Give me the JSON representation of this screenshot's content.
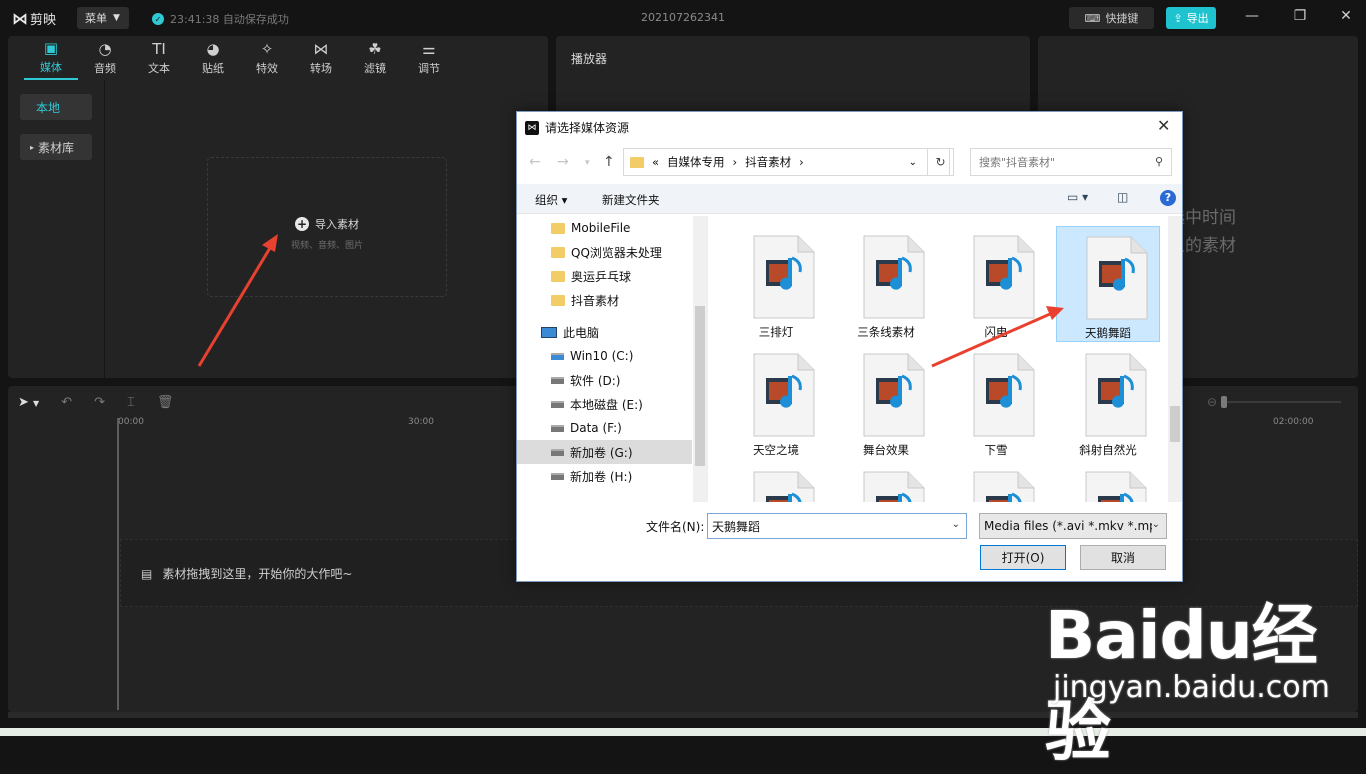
{
  "app": {
    "brand": "剪映",
    "menu_label": "菜单",
    "autosave": "23:41:38 自动保存成功",
    "project_name": "202107262341",
    "shortcut_label": "快捷键",
    "export_label": "导出"
  },
  "media_tabs": [
    {
      "label": "媒体",
      "icon": "media-icon"
    },
    {
      "label": "音频",
      "icon": "audio-icon"
    },
    {
      "label": "文本",
      "icon": "text-icon"
    },
    {
      "label": "贴纸",
      "icon": "sticker-icon"
    },
    {
      "label": "特效",
      "icon": "effects-icon"
    },
    {
      "label": "转场",
      "icon": "transition-icon"
    },
    {
      "label": "滤镜",
      "icon": "filter-icon"
    },
    {
      "label": "调节",
      "icon": "adjust-icon"
    }
  ],
  "media_side": {
    "local": "本地",
    "library": "素材库"
  },
  "import": {
    "label": "导入素材",
    "sub": "视频、音频、图片"
  },
  "player": {
    "title": "播放器"
  },
  "inspector": {
    "hint_line1": "选中时间",
    "hint_line2": "上的素材"
  },
  "timeline": {
    "ruler": [
      "00:00",
      "30:00",
      "02:00:00"
    ],
    "drop_hint": "素材拖拽到这里，开始你的大作吧~"
  },
  "dialog": {
    "title": "请选择媒体资源",
    "path": [
      "«",
      "自媒体专用",
      "›",
      "抖音素材",
      "›"
    ],
    "search_placeholder": "搜索\"抖音素材\"",
    "organize": "组织 ▾",
    "new_folder": "新建文件夹",
    "tree": [
      {
        "label": "MobileFile",
        "kind": "folder"
      },
      {
        "label": "QQ浏览器未处理",
        "kind": "folder"
      },
      {
        "label": "奥运乒乓球",
        "kind": "folder"
      },
      {
        "label": "抖音素材",
        "kind": "folder"
      },
      {
        "label": "此电脑",
        "kind": "pc"
      },
      {
        "label": "Win10 (C:)",
        "kind": "drive"
      },
      {
        "label": "软件 (D:)",
        "kind": "drive"
      },
      {
        "label": "本地磁盘 (E:)",
        "kind": "drive"
      },
      {
        "label": "Data (F:)",
        "kind": "drive"
      },
      {
        "label": "新加卷 (G:)",
        "kind": "drive"
      },
      {
        "label": "新加卷 (H:)",
        "kind": "drive"
      }
    ],
    "files": [
      "三排灯",
      "三条线素材",
      "闪电",
      "天鹅舞蹈",
      "天空之境",
      "舞台效果",
      "下雪",
      "斜射自然光"
    ],
    "selected_file": "天鹅舞蹈",
    "filename_label": "文件名(N):",
    "filename_value": "天鹅舞蹈",
    "filetype": "Media files (*.avi *.mkv *.mp",
    "open": "打开(O)",
    "cancel": "取消"
  },
  "watermark": {
    "brand": "Baidu经验",
    "url": "jingyan.baidu.com"
  },
  "colors": {
    "accent": "#2fc9d6",
    "annotation_arrow": "#e8412f"
  }
}
